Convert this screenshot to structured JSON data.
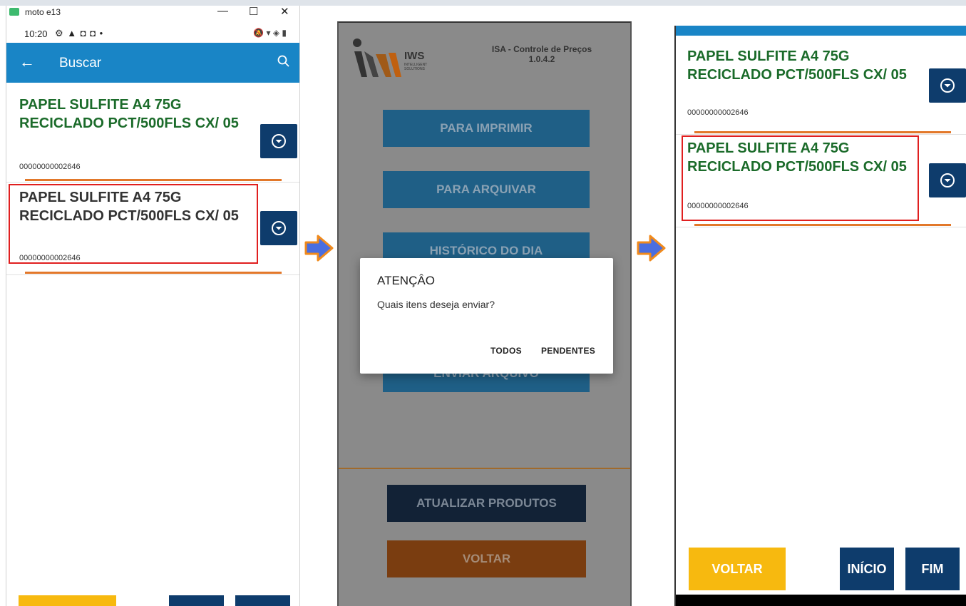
{
  "colors": {
    "appbar": "#1985c6",
    "green_text": "#1b6b2a",
    "dark_text": "#333333",
    "dropdown_button": "#0e3c6c",
    "orange_line": "#e2782a",
    "highlight": "#e01f1f",
    "yellow_button": "#f7b90f",
    "arrow": "#4a6ee0"
  },
  "panel1": {
    "window_title": "moto e13",
    "window_controls": [
      "—",
      "☐",
      "✕"
    ],
    "status_time": "10:20",
    "status_icons": "⚙ ▲ ◘ ◘ •",
    "status_right": "🔕 ▾ ◈ ▮",
    "appbar_title": "Buscar",
    "appbar_back_icon": "←",
    "items": [
      {
        "name": "PAPEL SULFITE A4 75G RECICLADO PCT/500FLS CX/ 05",
        "code": "00000000002646"
      },
      {
        "name": "PAPEL SULFITE A4 75G RECICLADO PCT/500FLS CX/ 05",
        "code": "00000000002646"
      }
    ]
  },
  "panel2": {
    "header": "ISA - Controle de Preços",
    "version": "1.0.4.2",
    "logo_text": "IWS",
    "logo_sub": "INTELLIGENT SOLUTIONS",
    "buttons": [
      "PARA IMPRIMIR",
      "PARA ARQUIVAR",
      "HISTÓRICO DO DIA",
      "ENVIAR ARQUIVO"
    ],
    "update_button": "ATUALIZAR PRODUTOS",
    "back_button": "VOLTAR",
    "dialog": {
      "title": "ATENÇÂO",
      "message": "Quais itens deseja enviar?",
      "option_all": "TODOS",
      "option_pending": "PENDENTES"
    }
  },
  "panel3": {
    "items": [
      {
        "name": "PAPEL SULFITE A4 75G RECICLADO PCT/500FLS CX/ 05",
        "code": "00000000002646"
      },
      {
        "name": "PAPEL SULFITE A4 75G RECICLADO PCT/500FLS CX/ 05",
        "code": "00000000002646"
      }
    ],
    "back_button": "VOLTAR",
    "start_button": "INÍCIO",
    "end_button": "FIM"
  }
}
